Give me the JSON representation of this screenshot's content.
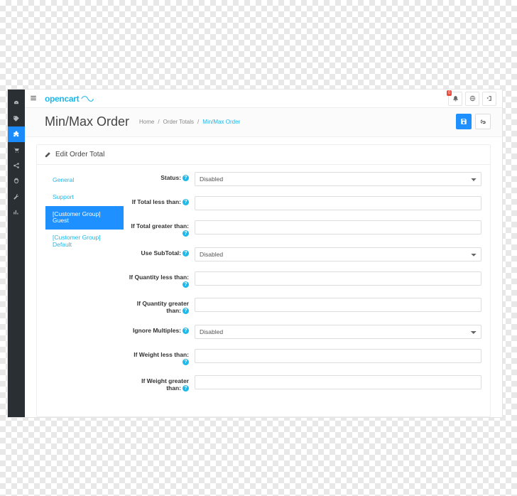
{
  "brand": "opencart",
  "topbar": {
    "badge": "0"
  },
  "page": {
    "title": "Min/Max Order",
    "crumbs": [
      "Home",
      "Order Totals",
      "Min/Max Order"
    ]
  },
  "actions": {
    "save_title": "Save",
    "back_title": "Cancel"
  },
  "panel": {
    "title": "Edit Order Total"
  },
  "tabs": [
    {
      "label": "General"
    },
    {
      "label": "Support"
    },
    {
      "label": "[Customer Group] Guest",
      "active": true
    },
    {
      "label": "[Customer Group] Default"
    }
  ],
  "form": {
    "status_label": "Status:",
    "status_value": "Disabled",
    "total_less_label": "If Total less than:",
    "total_less_value": "",
    "total_greater_label": "If Total greater than:",
    "total_greater_value": "",
    "subtotal_label": "Use SubTotal:",
    "subtotal_value": "Disabled",
    "qty_less_label": "If Quantity less than:",
    "qty_less_value": "",
    "qty_greater_label": "If Quantity greater than:",
    "qty_greater_value": "",
    "ignore_mult_label": "Ignore Multiples:",
    "ignore_mult_value": "Disabled",
    "weight_less_label": "If Weight less than:",
    "weight_less_value": "",
    "weight_greater_label": "If Weight greater than:",
    "weight_greater_value": ""
  }
}
